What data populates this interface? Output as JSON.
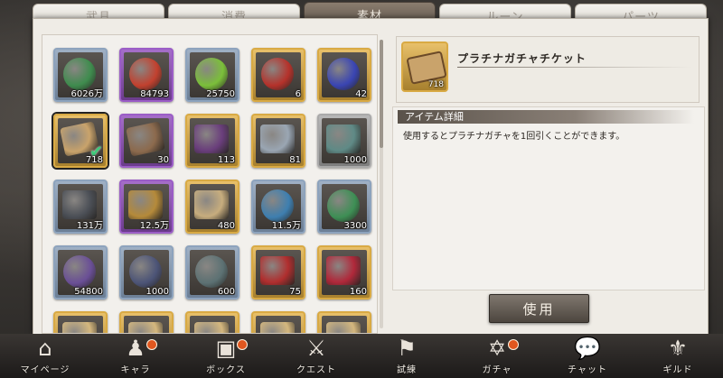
{
  "tabs": [
    {
      "label": "武具",
      "active": false
    },
    {
      "label": "消費",
      "active": false
    },
    {
      "label": "素材",
      "active": true
    },
    {
      "label": "ルーン",
      "active": false
    },
    {
      "label": "パーツ",
      "active": false
    }
  ],
  "items": [
    {
      "qty": "6026万",
      "rarity": "blue",
      "icon": "green-orb-icon",
      "color": "#3f8c4e"
    },
    {
      "qty": "84793",
      "rarity": "purple",
      "icon": "red-orb-icon",
      "color": "#c2412f"
    },
    {
      "qty": "25750",
      "rarity": "blue",
      "icon": "green-potion-icon",
      "color": "#7bbf3a"
    },
    {
      "qty": "6",
      "rarity": "gold",
      "icon": "red-potion-icon",
      "color": "#b5322b"
    },
    {
      "qty": "42",
      "rarity": "gold",
      "icon": "blue-potion-icon",
      "color": "#3a45b3"
    },
    {
      "qty": "718",
      "rarity": "gold",
      "icon": "platinum-ticket-icon",
      "color": "#c9a36b",
      "selected": true
    },
    {
      "qty": "30",
      "rarity": "purple",
      "icon": "ticket-icon",
      "color": "#8c6a4d"
    },
    {
      "qty": "113",
      "rarity": "gold",
      "icon": "purple-scroll-icon",
      "color": "#6a3e7c"
    },
    {
      "qty": "81",
      "rarity": "gold",
      "icon": "map-scroll-icon",
      "color": "#9aa6b3"
    },
    {
      "qty": "1000",
      "rarity": "gray",
      "icon": "heart-stone-icon",
      "color": "#5f8a86"
    },
    {
      "qty": "131万",
      "rarity": "blue",
      "icon": "iron-ore-icon",
      "color": "#4c5057"
    },
    {
      "qty": "12.5万",
      "rarity": "purple",
      "icon": "gold-ore-icon",
      "color": "#b58a3a"
    },
    {
      "qty": "480",
      "rarity": "gold",
      "icon": "stone-tablet-icon",
      "color": "#c7ad7e"
    },
    {
      "qty": "11.5万",
      "rarity": "blue",
      "icon": "blue-rune-coin-icon",
      "color": "#3e7fb0"
    },
    {
      "qty": "3300",
      "rarity": "blue",
      "icon": "green-rune-coin-icon",
      "color": "#3e8f55"
    },
    {
      "qty": "54800",
      "rarity": "blue",
      "icon": "purple-rune-coin-icon",
      "color": "#6a4f96"
    },
    {
      "qty": "1000",
      "rarity": "blue",
      "icon": "dark-rune-coin-icon",
      "color": "#4c5477"
    },
    {
      "qty": "600",
      "rarity": "blue",
      "icon": "gray-rune-coin-icon",
      "color": "#5c7173"
    },
    {
      "qty": "75",
      "rarity": "gold",
      "icon": "red-gem-icon",
      "color": "#b02e2e"
    },
    {
      "qty": "160",
      "rarity": "gold",
      "icon": "red-chest-icon",
      "color": "#b0283a"
    },
    {
      "qty": "",
      "rarity": "gold",
      "icon": "partial-item-icon",
      "color": "#d4b77e"
    },
    {
      "qty": "",
      "rarity": "gold",
      "icon": "partial-item-icon",
      "color": "#d4b77e"
    },
    {
      "qty": "",
      "rarity": "gold",
      "icon": "partial-item-icon",
      "color": "#d4b77e"
    },
    {
      "qty": "",
      "rarity": "gold",
      "icon": "partial-item-icon",
      "color": "#d4b77e"
    },
    {
      "qty": "",
      "rarity": "gold",
      "icon": "partial-item-icon",
      "color": "#d4b77e"
    }
  ],
  "detail": {
    "name": "プラチナガチャチケット",
    "qty": "718",
    "section_label": "アイテム詳細",
    "description": "使用するとプラチナガチャを1回引くことができます。",
    "use_label": "使用"
  },
  "nav": [
    {
      "label": "マイページ",
      "icon": "home-icon",
      "glyph": "⌂",
      "badge": false
    },
    {
      "label": "キャラ",
      "icon": "characters-icon",
      "glyph": "♟",
      "badge": true
    },
    {
      "label": "ボックス",
      "icon": "box-icon",
      "glyph": "▣",
      "badge": true
    },
    {
      "label": "クエスト",
      "icon": "swords-icon",
      "glyph": "⚔",
      "badge": false
    },
    {
      "label": "試練",
      "icon": "flag-icon",
      "glyph": "⚑",
      "badge": false
    },
    {
      "label": "ガチャ",
      "icon": "hexagram-icon",
      "glyph": "✡",
      "badge": true
    },
    {
      "label": "チャット",
      "icon": "chat-icon",
      "glyph": "💬",
      "badge": false
    },
    {
      "label": "ギルド",
      "icon": "guild-crest-icon",
      "glyph": "⚜",
      "badge": false
    }
  ]
}
